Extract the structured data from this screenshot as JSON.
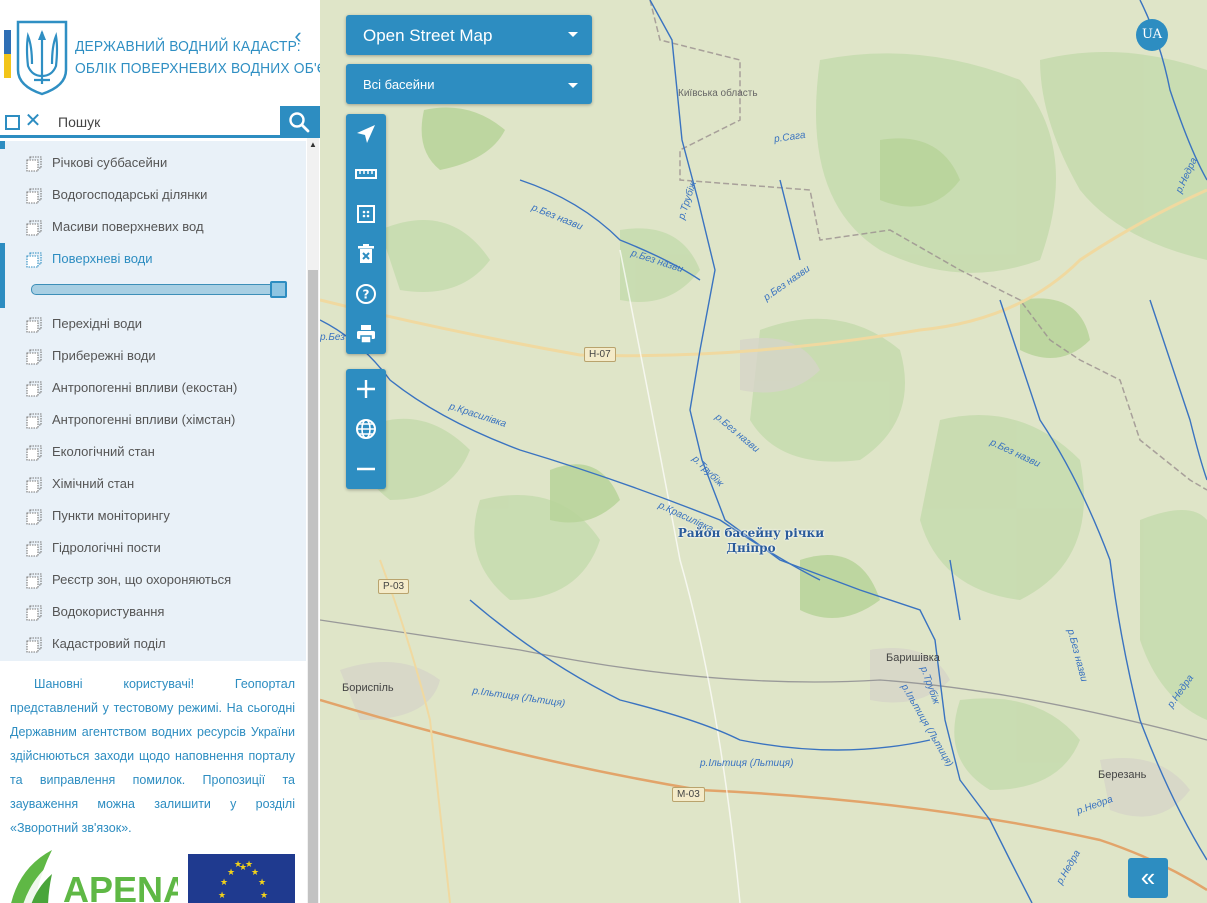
{
  "header": {
    "title_line1": "ДЕРЖАВНИЙ ВОДНИЙ КАДАСТР:",
    "title_line2": "ОБЛІК ПОВЕРХНЕВИХ ВОДНИХ ОБ'ЄКТІВ",
    "collapse_icon": "chevron-left-icon"
  },
  "search": {
    "placeholder": "Пошук",
    "value": ""
  },
  "layers": {
    "items": [
      {
        "label": "Річкові суббасейни",
        "active": false
      },
      {
        "label": "Водогосподарські ділянки",
        "active": false
      },
      {
        "label": "Масиви поверхневих вод",
        "active": false
      },
      {
        "label": "Поверхневі води",
        "active": true,
        "opacity": 1.0
      },
      {
        "label": "Перехідні води",
        "active": false
      },
      {
        "label": "Прибережні води",
        "active": false
      },
      {
        "label": "Антропогенні впливи (екостан)",
        "active": false
      },
      {
        "label": "Антропогенні впливи (хімстан)",
        "active": false
      },
      {
        "label": "Екологічний стан",
        "active": false
      },
      {
        "label": "Хімічний стан",
        "active": false
      },
      {
        "label": "Пункти моніторингу",
        "active": false
      },
      {
        "label": "Гідрологічні пости",
        "active": false
      },
      {
        "label": "Реєстр зон, що охороняються",
        "active": false
      },
      {
        "label": "Водокористування",
        "active": false
      },
      {
        "label": "Кадастровий поділ",
        "active": false
      }
    ]
  },
  "notice": {
    "text": "Шановні користувачі! Геопортал представлений у тестовому режимі. На сьогодні Державним агентством водних ресурсів України здійснюються заходи щодо наповнення порталу та виправлення помилок. Пропозиції та зауваження можна залишити у розділі «Зворотний зв'язок»."
  },
  "logos": {
    "apena_text": "APENA"
  },
  "map": {
    "basemap_select": "Open Street Map",
    "basin_select": "Всі басейни",
    "language": "UA",
    "basin_label_line1": "Район басейну річки",
    "basin_label_line2": "Дніпро",
    "oblast_label": "Київська область",
    "places": [
      "Бориспіль",
      "Баришівка",
      "Березань"
    ],
    "road_tags": [
      "Н-07",
      "Р-03",
      "М-03"
    ],
    "river_labels": [
      "р.Сага",
      "р.Без назви",
      "р.Без назви",
      "р.Без назви",
      "р.Трубіж",
      "р.Красилівка",
      "р.Без назви",
      "р.Трубіж",
      "р.Красилівка",
      "р.Без назви",
      "р.Недра",
      "р.Без назви",
      "р.Ільтиця (Льтиця)",
      "р.Ільтиця (Льтиця)",
      "р.Трубіж",
      "р.Ільтиця (Льтиця)",
      "р.Недра",
      "р.Недра",
      "р.Недра",
      "р.Без назви"
    ],
    "tools": [
      "locate-icon",
      "ruler-icon",
      "area-measure-icon",
      "delete-icon",
      "help-icon",
      "print-icon"
    ],
    "zoom_tools": [
      "zoom-in-icon",
      "globe-icon",
      "zoom-out-icon"
    ],
    "expand_icon": "double-chevron-left-icon"
  },
  "colors": {
    "accent": "#2d8dc1",
    "map_bg": "#dfe5c8",
    "forest": "#c5dcae",
    "river": "#3a73c0"
  }
}
